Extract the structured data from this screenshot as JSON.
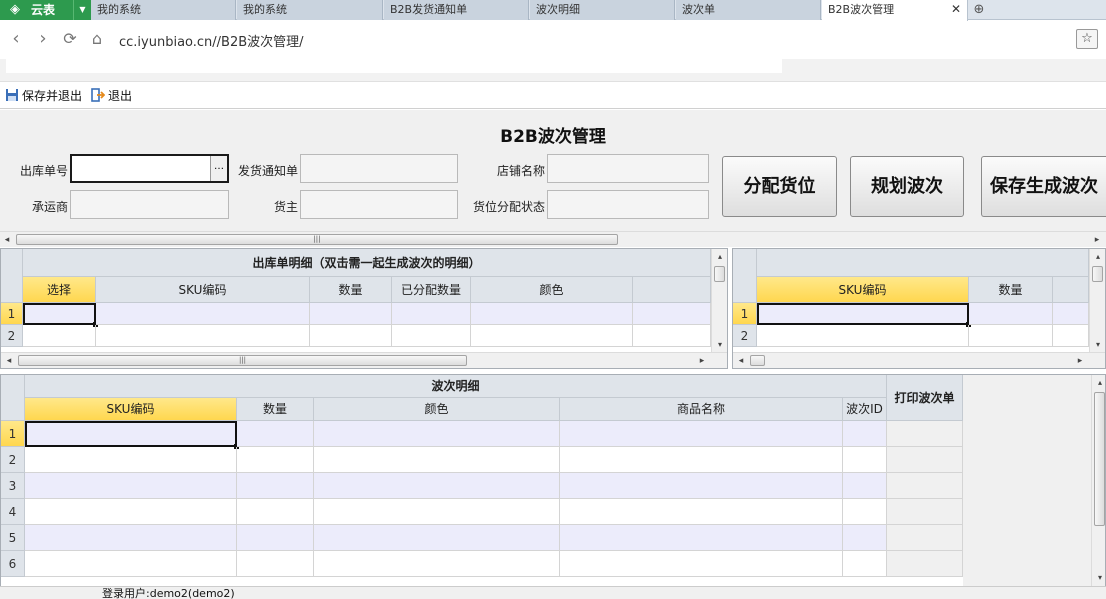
{
  "browser": {
    "brand_logo": "◈",
    "brand_name": "云表",
    "tabs": [
      {
        "label": "我的系统"
      },
      {
        "label": "我的系统"
      },
      {
        "label": "B2B发货通知单"
      },
      {
        "label": "波次明细"
      },
      {
        "label": "波次单"
      },
      {
        "label": "B2B波次管理",
        "close": "✕"
      }
    ],
    "url": "cc.iyunbiao.cn//B2B波次管理/"
  },
  "toolbar": {
    "save_exit": "保存并退出",
    "exit": "退出"
  },
  "form": {
    "title": "B2B波次管理",
    "fields": {
      "outbound_no": "出库单号",
      "delivery_notice": "发货通知单",
      "shop_name": "店铺名称",
      "carrier": "承运商",
      "owner": "货主",
      "location_status": "货位分配状态"
    },
    "buttons": {
      "allocate": "分配货位",
      "plan": "规划波次",
      "save_generate": "保存生成波次"
    }
  },
  "grid1": {
    "caption": "出库单明细（双击需一起生成波次的明细）",
    "columns": [
      "选择",
      "SKU编码",
      "数量",
      "已分配数量",
      "颜色"
    ],
    "rows": [
      "1",
      "2"
    ]
  },
  "grid2": {
    "columns": [
      "SKU编码",
      "数量"
    ],
    "rows": [
      "1",
      "2"
    ]
  },
  "grid3": {
    "caption": "波次明细",
    "columns": [
      "SKU编码",
      "数量",
      "颜色",
      "商品名称",
      "波次ID"
    ],
    "print_label": "打印波次单",
    "rows": [
      "1",
      "2",
      "3",
      "4",
      "5",
      "6"
    ]
  },
  "status": {
    "login": "登录用户:demo2(demo2)"
  }
}
